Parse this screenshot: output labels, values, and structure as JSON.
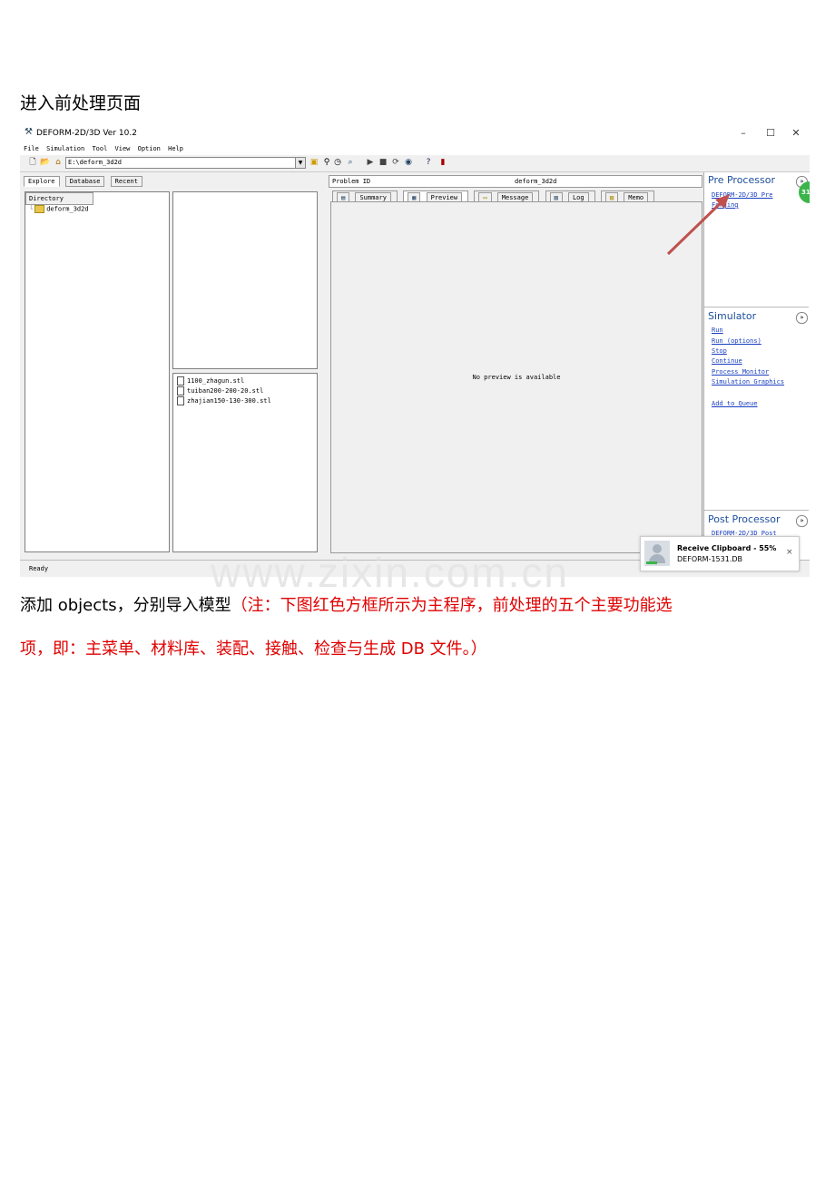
{
  "heading": "进入前处理页面",
  "app": {
    "title": "DEFORM-2D/3D  Ver 10.2",
    "window_controls": [
      "–",
      "☐",
      "✕"
    ],
    "menu": [
      "File",
      "Simulation",
      "Tool",
      "View",
      "Option",
      "Help"
    ],
    "path": "E:\\deform_3d2d",
    "explorer_tabs": [
      "Explore",
      "Database",
      "Recent"
    ],
    "directory_header": "Directory",
    "tree_item": "deform_3d2d",
    "files": [
      "1100_zhagun.stl",
      "tuiban200-200-20.stl",
      "zhajian150-130-300.stl"
    ],
    "problem_id_label": "Problem ID",
    "problem_id_value": "deform_3d2d",
    "content_tabs": [
      "Summary",
      "Preview",
      "Message",
      "Log",
      "Memo"
    ],
    "preview_text": "No preview is available",
    "pre_processor": {
      "title": "Pre Processor",
      "links": [
        "DEFORM-2D/3D Pre",
        "Forging"
      ]
    },
    "simulator": {
      "title": "Simulator",
      "links": [
        "Run",
        "Run (options)",
        "Stop",
        "Continue",
        "Process Monitor",
        "Simulation Graphics",
        "Add to Queue"
      ]
    },
    "post_processor": {
      "title": "Post Processor",
      "links": [
        "DEFORM-2D/3D Post"
      ]
    },
    "status": "Ready",
    "badge": "31",
    "toast": {
      "title": "Receive Clipboard - 55%",
      "file": "DEFORM-1531.DB",
      "close": "×"
    }
  },
  "watermark": "www.zixin.com.cn",
  "paragraph": {
    "part1": "添加 objects，分别导入模型",
    "part2": "（注：下图红色方框所示为主程序，前处理的五个主要功能选",
    "part3": "项，即：主菜单、材料库、装配、接触、检查与生成 DB 文件。）"
  },
  "colors": {
    "link": "#1a3fc0",
    "section_title": "#1c4f9c",
    "annotation_red": "#e00000",
    "arrow": "#c0504d",
    "badge": "#3bb54a"
  }
}
